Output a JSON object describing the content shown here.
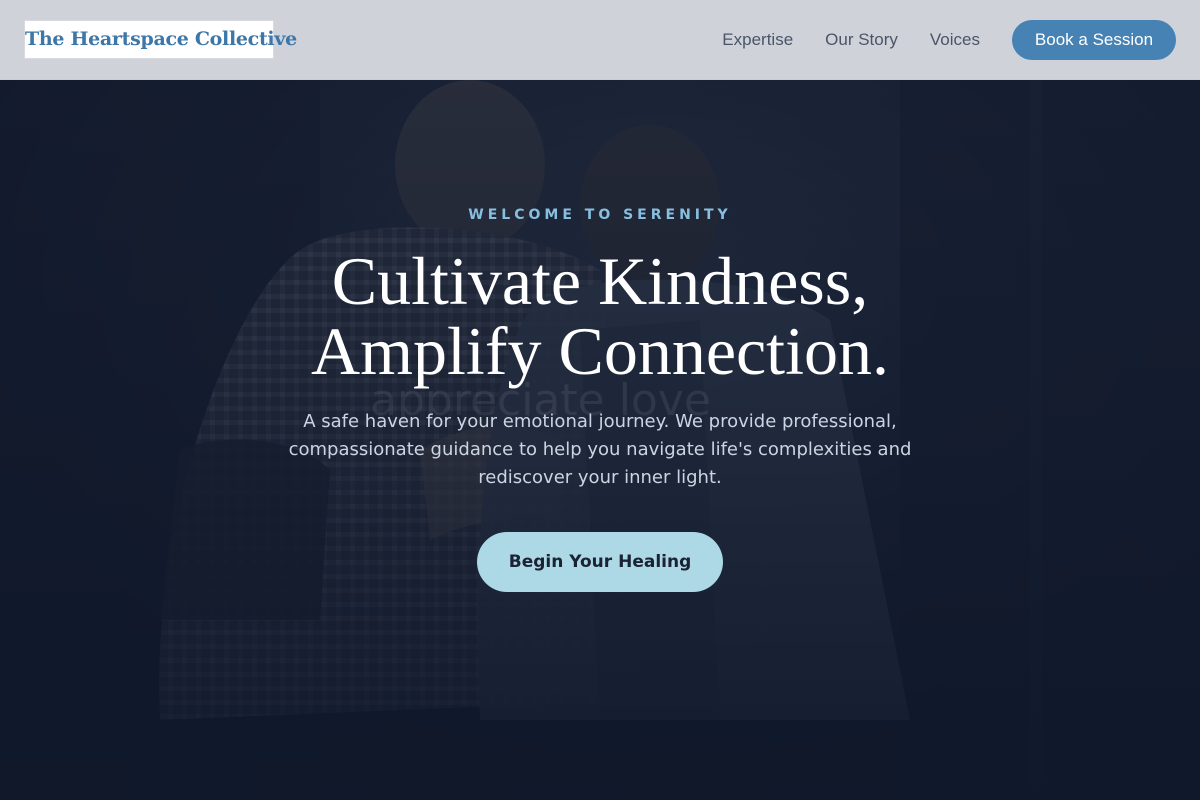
{
  "brand": {
    "name": "The Heartspace Collective",
    "color": "#3d76a8"
  },
  "nav": {
    "links": [
      {
        "label": "Expertise"
      },
      {
        "label": "Our Story"
      },
      {
        "label": "Voices"
      }
    ],
    "cta_label": "Book a Session",
    "cta_color": "#4682b4"
  },
  "hero": {
    "eyebrow": "WELCOME TO SERENITY",
    "headline_line1": "Cultivate Kindness,",
    "headline_line2": "Amplify Connection.",
    "subtext": "A safe haven for your emotional journey. We provide professional, compassionate guidance to help you navigate life's complexities and rediscover your inner light.",
    "cta_label": "Begin Your Healing",
    "cta_color": "#add8e6",
    "background_image": "photo-two-people-embracing-comfort",
    "watermark_text": "appreciate love"
  }
}
